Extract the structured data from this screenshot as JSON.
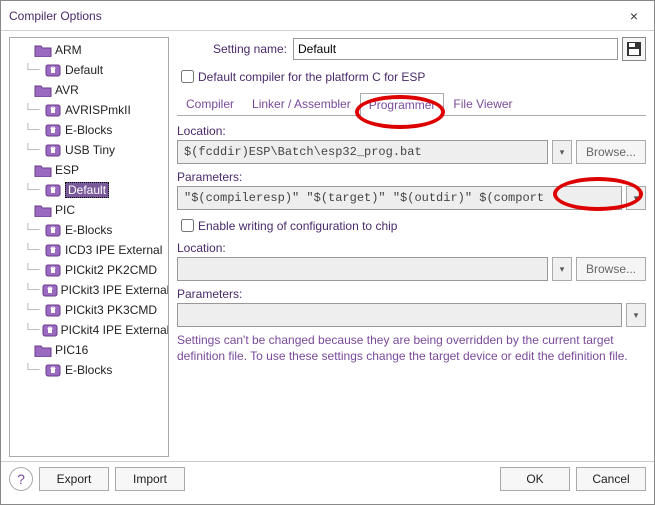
{
  "window": {
    "title": "Compiler Options",
    "close": "×"
  },
  "tree": {
    "nodes": [
      {
        "type": "folder",
        "label": "ARM"
      },
      {
        "type": "item",
        "label": "Default"
      },
      {
        "type": "folder",
        "label": "AVR"
      },
      {
        "type": "item",
        "label": "AVRISPmkII"
      },
      {
        "type": "item",
        "label": "E-Blocks"
      },
      {
        "type": "item",
        "label": "USB Tiny"
      },
      {
        "type": "folder",
        "label": "ESP"
      },
      {
        "type": "item",
        "label": "Default",
        "selected": true
      },
      {
        "type": "folder",
        "label": "PIC"
      },
      {
        "type": "item",
        "label": "E-Blocks"
      },
      {
        "type": "item",
        "label": "ICD3 IPE External"
      },
      {
        "type": "item",
        "label": "PICkit2 PK2CMD"
      },
      {
        "type": "item",
        "label": "PICkit3 IPE External"
      },
      {
        "type": "item",
        "label": "PICkit3 PK3CMD"
      },
      {
        "type": "item",
        "label": "PICkit4 IPE External"
      },
      {
        "type": "folder",
        "label": "PIC16"
      },
      {
        "type": "item",
        "label": "E-Blocks"
      }
    ]
  },
  "main": {
    "setting_name_label": "Setting name:",
    "setting_name_value": "Default",
    "default_compiler_label": "Default compiler for the platform C for ESP",
    "tabs": {
      "compiler": "Compiler",
      "linker": "Linker / Assembler",
      "programmer": "Programmer",
      "fileviewer": "File Viewer"
    },
    "location_label": "Location:",
    "location_value": "$(fcddir)ESP\\Batch\\esp32_prog.bat",
    "parameters_label": "Parameters:",
    "parameters_value": "\"$(compileresp)\" \"$(target)\" \"$(outdir)\" $(comport",
    "enable_writing_label": "Enable writing of configuration to chip",
    "location2_label": "Location:",
    "location2_value": "",
    "parameters2_label": "Parameters:",
    "parameters2_value": "",
    "browse_label": "Browse...",
    "dropdown_glyph": "▾",
    "note": "Settings can't be changed because they are being overridden by the current target definition file. To use these settings change the target device or edit the definition file."
  },
  "footer": {
    "help": "?",
    "export": "Export",
    "import": "Import",
    "ok": "OK",
    "cancel": "Cancel"
  },
  "colors": {
    "accent": "#7a4a9a",
    "annot": "#d00000"
  }
}
